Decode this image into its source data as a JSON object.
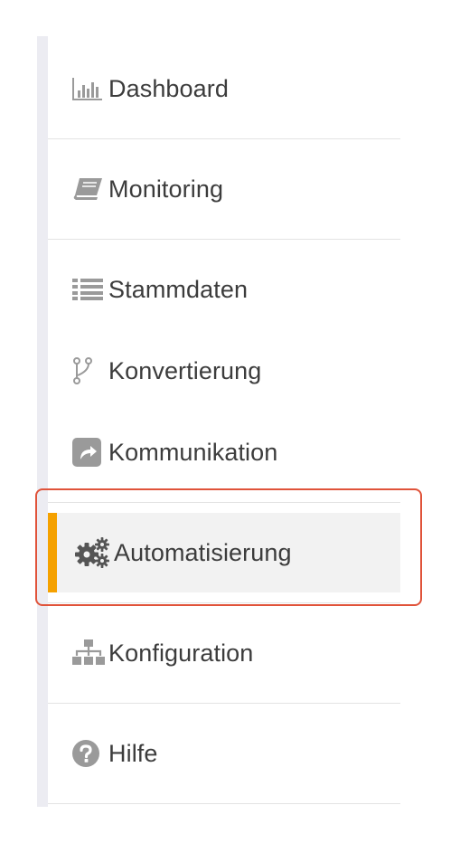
{
  "sidebar": {
    "items": [
      {
        "label": "Dashboard",
        "icon": "bar-chart-icon"
      },
      {
        "label": "Monitoring",
        "icon": "book-icon"
      },
      {
        "label": "Stammdaten",
        "icon": "list-icon"
      },
      {
        "label": "Konvertierung",
        "icon": "branch-icon"
      },
      {
        "label": "Kommunikation",
        "icon": "share-square-icon"
      },
      {
        "label": "Automatisierung",
        "icon": "gears-icon",
        "active": true
      },
      {
        "label": "Konfiguration",
        "icon": "sitemap-icon"
      },
      {
        "label": "Hilfe",
        "icon": "question-circle-icon"
      }
    ],
    "active_index": 5
  },
  "colors": {
    "icon": "#9a9a9a",
    "active_icon": "#555555",
    "active_bar": "#f5a100",
    "active_background": "#f2f2f2",
    "highlight_border": "#e0533a",
    "rail": "#ececf2",
    "divider": "#e3e3e3",
    "text": "#3c3c3c"
  }
}
